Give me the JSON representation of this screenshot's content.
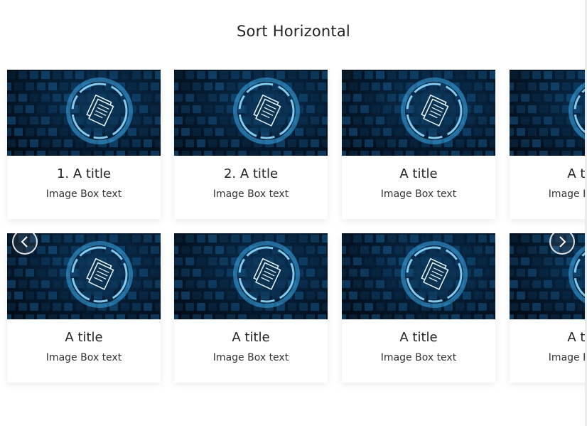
{
  "header": {
    "title": "Sort Horizontal"
  },
  "rows": [
    {
      "cards": [
        {
          "title": "1. A title",
          "text": "Image Box text",
          "image": "document-network-icon"
        },
        {
          "title": "2. A title",
          "text": "Image Box text",
          "image": "document-network-icon"
        },
        {
          "title": "A title",
          "text": "Image Box text",
          "image": "document-network-icon"
        },
        {
          "title": "A title",
          "text": "Image Box text",
          "image": "document-network-icon"
        }
      ]
    },
    {
      "cards": [
        {
          "title": "A title",
          "text": "Image Box text",
          "image": "document-network-icon"
        },
        {
          "title": "A title",
          "text": "Image Box text",
          "image": "document-network-icon"
        },
        {
          "title": "A title",
          "text": "Image Box text",
          "image": "document-network-icon"
        },
        {
          "title": "A title",
          "text": "Image Box text",
          "image": "document-network-icon"
        }
      ]
    }
  ],
  "navigation": {
    "prev_icon": "chevron-left-icon",
    "next_icon": "chevron-right-icon"
  },
  "colors": {
    "image_dark": "#04111f",
    "image_glow": "#5cc8ff",
    "text": "#222222"
  }
}
